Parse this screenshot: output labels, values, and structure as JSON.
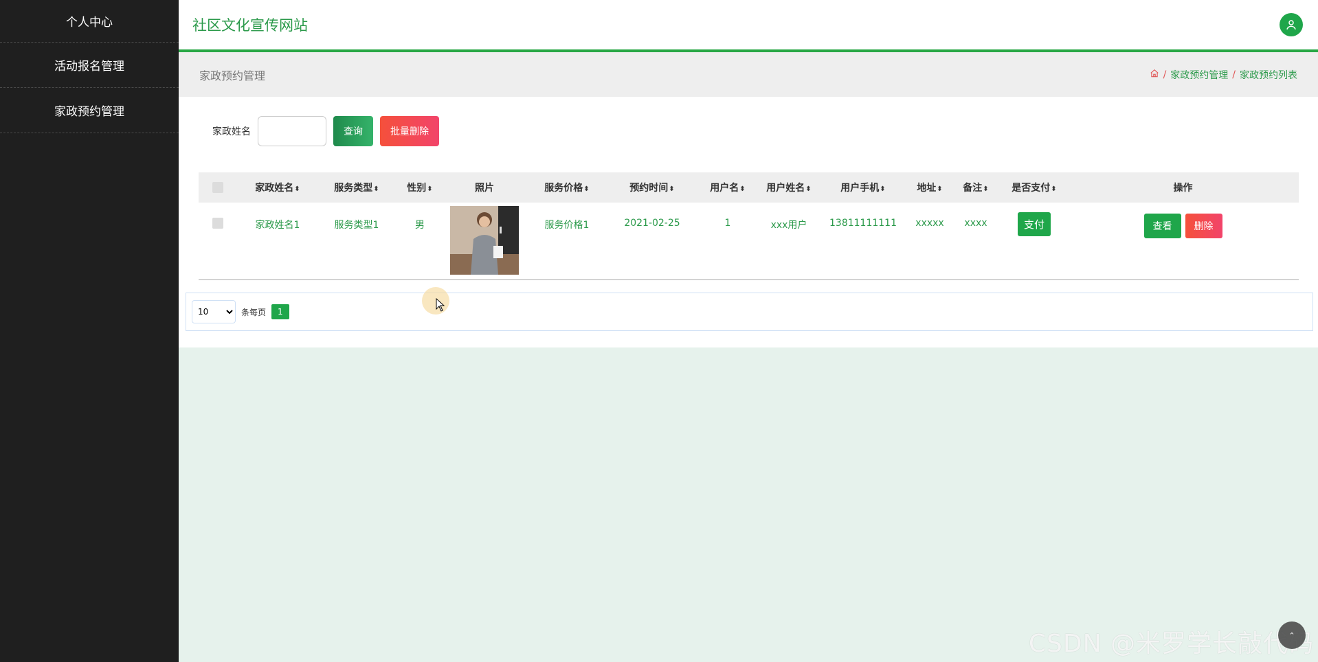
{
  "sidebar": {
    "items": [
      {
        "label": "个人中心"
      },
      {
        "label": "活动报名管理"
      },
      {
        "label": "家政预约管理"
      }
    ]
  },
  "header": {
    "site_title": "社区文化宣传网站",
    "user_icon": "user-icon"
  },
  "breadcrumb": {
    "page_title": "家政预约管理",
    "home_icon": "home-icon",
    "items": [
      "家政预约管理",
      "家政预约列表"
    ],
    "separator": "/"
  },
  "search": {
    "label": "家政姓名",
    "value": "",
    "query_label": "查询",
    "batch_delete_label": "批量删除"
  },
  "table": {
    "columns": [
      "家政姓名",
      "服务类型",
      "性别",
      "照片",
      "服务价格",
      "预约时间",
      "用户名",
      "用户姓名",
      "用户手机",
      "地址",
      "备注",
      "是否支付",
      "操作"
    ],
    "rows": [
      {
        "name": "家政姓名1",
        "service_type": "服务类型1",
        "gender": "男",
        "price": "服务价格1",
        "time": "2021-02-25",
        "username": "1",
        "user_realname": "xxx用户",
        "phone": "13811111111",
        "address": "xxxxx",
        "remark": "xxxx",
        "pay_label": "支付",
        "view_label": "查看",
        "delete_label": "删除"
      }
    ]
  },
  "pagination": {
    "page_size": "10",
    "page_size_options": [
      "10"
    ],
    "per_page_label": "条每页",
    "current_page": "1"
  },
  "watermark": "CSDN @米罗学长敲代码",
  "colors": {
    "sidebar_bg": "#1f1f1f",
    "accent_green": "#1fa64a",
    "danger": "#f2446a",
    "page_bg": "#e6f2ec"
  }
}
